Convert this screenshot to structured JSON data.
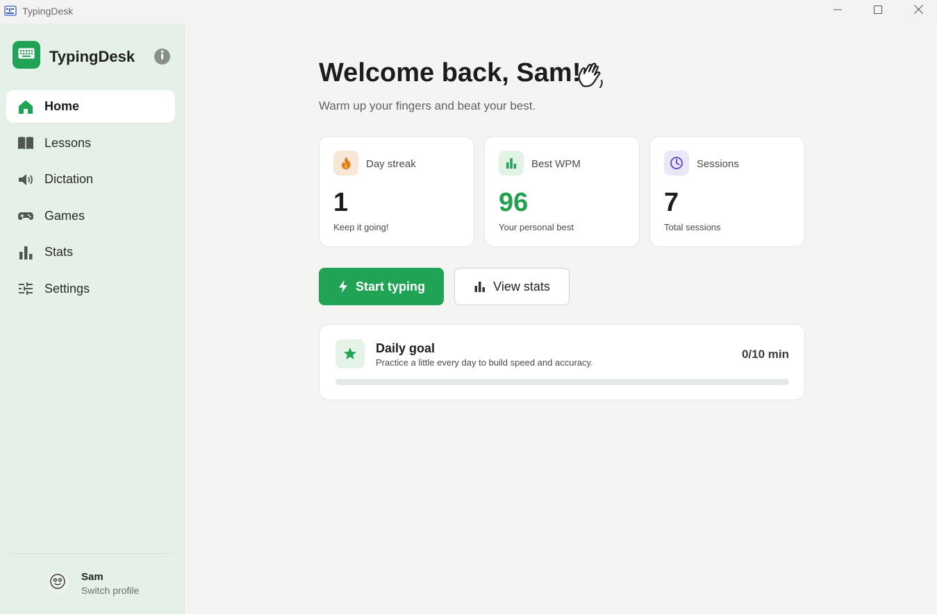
{
  "window": {
    "title": "TypingDesk",
    "icons": {
      "app": "typewriter-icon",
      "minimize": "minimize-icon",
      "maximize": "maximize-icon",
      "close": "close-icon"
    }
  },
  "sidebar": {
    "brand": "TypingDesk",
    "brand_icon": "keyboard-icon",
    "info_icon": "info-icon",
    "items": [
      {
        "label": "Home",
        "icon": "home-icon",
        "active": true
      },
      {
        "label": "Lessons",
        "icon": "book-icon",
        "active": false
      },
      {
        "label": "Dictation",
        "icon": "speaker-icon",
        "active": false
      },
      {
        "label": "Games",
        "icon": "gamepad-icon",
        "active": false
      },
      {
        "label": "Stats",
        "icon": "bar-chart-icon",
        "active": false
      },
      {
        "label": "Settings",
        "icon": "sliders-icon",
        "active": false
      }
    ],
    "profile": {
      "name": "Sam",
      "action": "Switch profile",
      "icon": "smiley-icon"
    }
  },
  "main": {
    "welcome": "Welcome back, Sam!",
    "welcome_icon": "waving-hand-icon",
    "subtitle": "Warm up your fingers and beat your best.",
    "stats": [
      {
        "label": "Day streak",
        "value": "1",
        "caption": "Keep it going!",
        "icon": "flame-icon",
        "color": "#f8e7d6"
      },
      {
        "label": "Best WPM",
        "value": "96",
        "caption": "Your personal best",
        "icon": "bar-chart-icon",
        "color": "#e2f3e6"
      },
      {
        "label": "Sessions",
        "value": "7",
        "caption": "Total sessions",
        "icon": "clock-icon",
        "color": "#ebe7fa"
      }
    ],
    "actions": {
      "start_label": "Start typing",
      "start_icon": "lightning-icon",
      "stats_label": "View stats",
      "stats_icon": "bar-chart-icon"
    },
    "goal": {
      "title": "Daily goal",
      "description": "Practice a little every day to build speed and accuracy.",
      "progress_text": "0/10 min",
      "progress": 0,
      "icon": "star-icon"
    }
  },
  "colors": {
    "accent": "#21a355",
    "sidebar_bg": "#e5f1e8",
    "main_bg": "#f4f5f2",
    "wpm_green": "#22a04f"
  }
}
